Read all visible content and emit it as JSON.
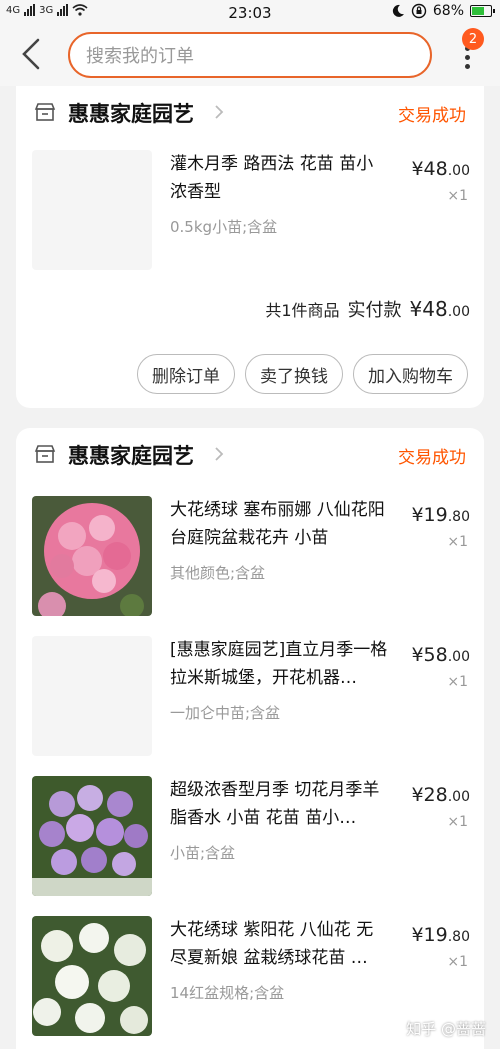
{
  "status_bar": {
    "network_left": "4G",
    "network_right": "3G",
    "time": "23:03",
    "battery": "68%",
    "battery_level": 0.68
  },
  "header": {
    "search_placeholder": "搜索我的订单",
    "badge_count": "2"
  },
  "orders": [
    {
      "shop": "惠惠家庭园艺",
      "status": "交易成功",
      "items": [
        {
          "title": "灌木月季 路西法 花苗 苗小浓香型",
          "spec": "0.5kg小苗;含盆",
          "price_main": "¥48",
          "price_decimal": ".00",
          "qty": "×1"
        }
      ],
      "summary_count": "共1件商品",
      "summary_label": "实付款",
      "summary_amount_main": "¥48",
      "summary_amount_decimal": ".00",
      "actions": [
        "删除订单",
        "卖了换钱",
        "加入购物车"
      ]
    },
    {
      "shop": "惠惠家庭园艺",
      "status": "交易成功",
      "items": [
        {
          "title": "大花绣球 塞布丽娜 八仙花阳台庭院盆栽花卉  小苗",
          "spec": "其他颜色;含盆",
          "price_main": "¥19",
          "price_decimal": ".80",
          "qty": "×1"
        },
        {
          "title": "[惠惠家庭园艺]直立月季一格拉米斯城堡，开花机器…",
          "spec": "一加仑中苗;含盆",
          "price_main": "¥58",
          "price_decimal": ".00",
          "qty": "×1"
        },
        {
          "title": "超级浓香型月季 切花月季羊脂香水 小苗 花苗 苗小…",
          "spec": "小苗;含盆",
          "price_main": "¥28",
          "price_decimal": ".00",
          "qty": "×1"
        },
        {
          "title": "大花绣球 紫阳花 八仙花 无尽夏新娘 盆栽绣球花苗 …",
          "spec": "14红盆规格;含盆",
          "price_main": "¥19",
          "price_decimal": ".80",
          "qty": "×1"
        }
      ]
    }
  ],
  "watermark": "知乎 @蔷蔷",
  "colors": {
    "accent": "#ff5500",
    "search_border": "#e8652a",
    "badge": "#ff5a1f"
  }
}
